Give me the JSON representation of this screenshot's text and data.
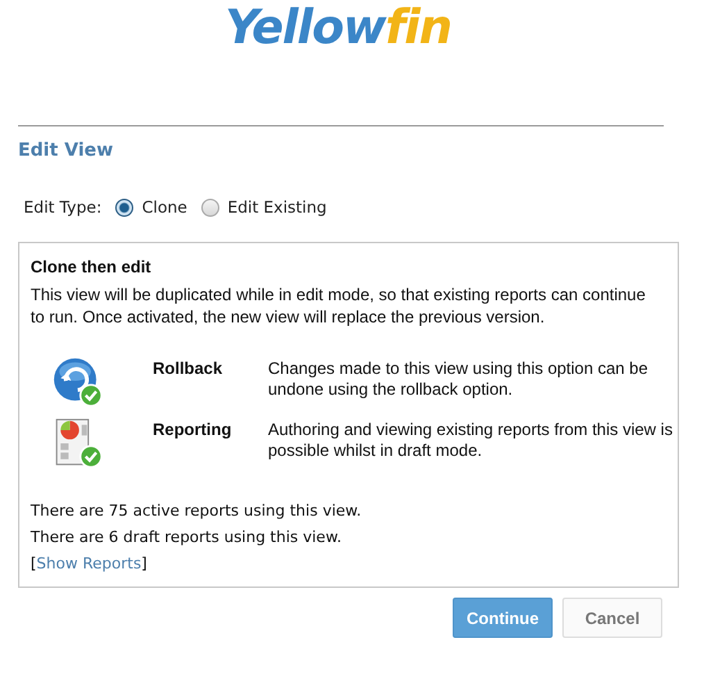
{
  "logo": {
    "part_1": "Yellow",
    "part_2": "fin"
  },
  "heading": "Edit View",
  "edit_type": {
    "label": "Edit Type:",
    "options": [
      {
        "label": "Clone",
        "selected": true
      },
      {
        "label": "Edit Existing",
        "selected": false
      }
    ]
  },
  "panel": {
    "title": "Clone then edit",
    "description": "This view will be duplicated while in edit mode, so that existing reports can continue to run. Once activated, the new view will replace the previous version.",
    "features": [
      {
        "kind": "rollback",
        "name": "Rollback",
        "text": "Changes made to this view using this option can be undone using the rollback option."
      },
      {
        "kind": "reporting",
        "name": "Reporting",
        "text": "Authoring and viewing existing reports from this view is possible whilst in draft mode."
      }
    ],
    "counts": [
      "There are 75 active reports using this view.",
      "There are 6 draft reports using this view."
    ],
    "show_reports": {
      "open": "[",
      "label": "Show Reports",
      "close": "]"
    }
  },
  "buttons": [
    {
      "kind": "primary",
      "label": "Continue"
    },
    {
      "kind": "secondary",
      "label": "Cancel"
    }
  ]
}
